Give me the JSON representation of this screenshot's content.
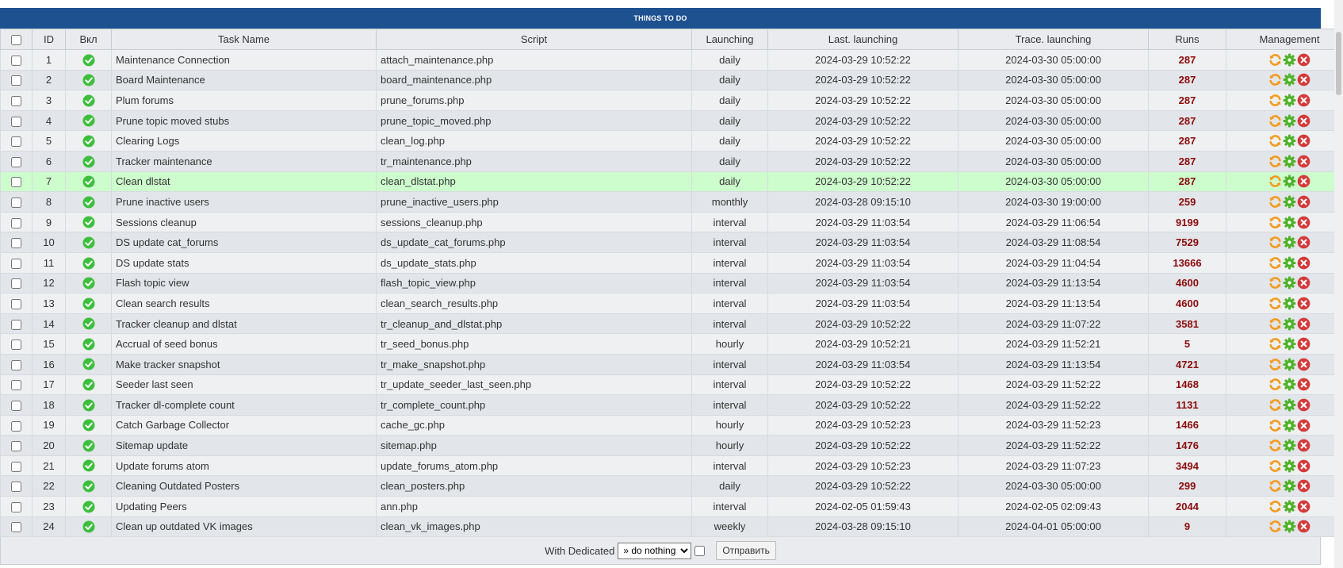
{
  "title": "THINGS TO DO",
  "columns": [
    "",
    "ID",
    "Вкл",
    "Task Name",
    "Script",
    "Launching",
    "Last. launching",
    "Trace. launching",
    "Runs",
    "Management"
  ],
  "rows": [
    {
      "id": "1",
      "name": "Maintenance Connection",
      "script": "attach_maintenance.php",
      "launching": "daily",
      "last": "2024-03-29 10:52:22",
      "next": "2024-03-30 05:00:00",
      "runs": "287"
    },
    {
      "id": "2",
      "name": "Board Maintenance",
      "script": "board_maintenance.php",
      "launching": "daily",
      "last": "2024-03-29 10:52:22",
      "next": "2024-03-30 05:00:00",
      "runs": "287"
    },
    {
      "id": "3",
      "name": "Plum forums",
      "script": "prune_forums.php",
      "launching": "daily",
      "last": "2024-03-29 10:52:22",
      "next": "2024-03-30 05:00:00",
      "runs": "287"
    },
    {
      "id": "4",
      "name": "Prune topic moved stubs",
      "script": "prune_topic_moved.php",
      "launching": "daily",
      "last": "2024-03-29 10:52:22",
      "next": "2024-03-30 05:00:00",
      "runs": "287"
    },
    {
      "id": "5",
      "name": "Clearing Logs",
      "script": "clean_log.php",
      "launching": "daily",
      "last": "2024-03-29 10:52:22",
      "next": "2024-03-30 05:00:00",
      "runs": "287"
    },
    {
      "id": "6",
      "name": "Tracker maintenance",
      "script": "tr_maintenance.php",
      "launching": "daily",
      "last": "2024-03-29 10:52:22",
      "next": "2024-03-30 05:00:00",
      "runs": "287"
    },
    {
      "id": "7",
      "name": "Clean dlstat",
      "script": "clean_dlstat.php",
      "launching": "daily",
      "last": "2024-03-29 10:52:22",
      "next": "2024-03-30 05:00:00",
      "runs": "287",
      "highlight": true
    },
    {
      "id": "8",
      "name": "Prune inactive users",
      "script": "prune_inactive_users.php",
      "launching": "monthly",
      "last": "2024-03-28 09:15:10",
      "next": "2024-03-30 19:00:00",
      "runs": "259"
    },
    {
      "id": "9",
      "name": "Sessions cleanup",
      "script": "sessions_cleanup.php",
      "launching": "interval",
      "last": "2024-03-29 11:03:54",
      "next": "2024-03-29 11:06:54",
      "runs": "9199"
    },
    {
      "id": "10",
      "name": "DS update cat_forums",
      "script": "ds_update_cat_forums.php",
      "launching": "interval",
      "last": "2024-03-29 11:03:54",
      "next": "2024-03-29 11:08:54",
      "runs": "7529"
    },
    {
      "id": "11",
      "name": "DS update stats",
      "script": "ds_update_stats.php",
      "launching": "interval",
      "last": "2024-03-29 11:03:54",
      "next": "2024-03-29 11:04:54",
      "runs": "13666"
    },
    {
      "id": "12",
      "name": "Flash topic view",
      "script": "flash_topic_view.php",
      "launching": "interval",
      "last": "2024-03-29 11:03:54",
      "next": "2024-03-29 11:13:54",
      "runs": "4600"
    },
    {
      "id": "13",
      "name": "Clean search results",
      "script": "clean_search_results.php",
      "launching": "interval",
      "last": "2024-03-29 11:03:54",
      "next": "2024-03-29 11:13:54",
      "runs": "4600"
    },
    {
      "id": "14",
      "name": "Tracker cleanup and dlstat",
      "script": "tr_cleanup_and_dlstat.php",
      "launching": "interval",
      "last": "2024-03-29 10:52:22",
      "next": "2024-03-29 11:07:22",
      "runs": "3581"
    },
    {
      "id": "15",
      "name": "Accrual of seed bonus",
      "script": "tr_seed_bonus.php",
      "launching": "hourly",
      "last": "2024-03-29 10:52:21",
      "next": "2024-03-29 11:52:21",
      "runs": "5"
    },
    {
      "id": "16",
      "name": "Make tracker snapshot",
      "script": "tr_make_snapshot.php",
      "launching": "interval",
      "last": "2024-03-29 11:03:54",
      "next": "2024-03-29 11:13:54",
      "runs": "4721"
    },
    {
      "id": "17",
      "name": "Seeder last seen",
      "script": "tr_update_seeder_last_seen.php",
      "launching": "interval",
      "last": "2024-03-29 10:52:22",
      "next": "2024-03-29 11:52:22",
      "runs": "1468"
    },
    {
      "id": "18",
      "name": "Tracker dl-complete count",
      "script": "tr_complete_count.php",
      "launching": "interval",
      "last": "2024-03-29 10:52:22",
      "next": "2024-03-29 11:52:22",
      "runs": "1131"
    },
    {
      "id": "19",
      "name": "Catch Garbage Collector",
      "script": "cache_gc.php",
      "launching": "hourly",
      "last": "2024-03-29 10:52:23",
      "next": "2024-03-29 11:52:23",
      "runs": "1466"
    },
    {
      "id": "20",
      "name": "Sitemap update",
      "script": "sitemap.php",
      "launching": "hourly",
      "last": "2024-03-29 10:52:22",
      "next": "2024-03-29 11:52:22",
      "runs": "1476"
    },
    {
      "id": "21",
      "name": "Update forums atom",
      "script": "update_forums_atom.php",
      "launching": "interval",
      "last": "2024-03-29 10:52:23",
      "next": "2024-03-29 11:07:23",
      "runs": "3494"
    },
    {
      "id": "22",
      "name": "Cleaning Outdated Posters",
      "script": "clean_posters.php",
      "launching": "daily",
      "last": "2024-03-29 10:52:22",
      "next": "2024-03-30 05:00:00",
      "runs": "299"
    },
    {
      "id": "23",
      "name": "Updating Peers",
      "script": "ann.php",
      "launching": "interval",
      "last": "2024-02-05 01:59:43",
      "next": "2024-02-05 02:09:43",
      "runs": "2044"
    },
    {
      "id": "24",
      "name": "Clean up outdated VK images",
      "script": "clean_vk_images.php",
      "launching": "weekly",
      "last": "2024-03-28 09:15:10",
      "next": "2024-04-01 05:00:00",
      "runs": "9"
    }
  ],
  "icons": {
    "enabled": "check-circle-icon",
    "run": "refresh-icon",
    "edit": "gear-icon",
    "delete": "close-circle-icon"
  },
  "colors": {
    "header_bar": "#1e5190",
    "runs": "#8b0b0b",
    "highlight_row": "#cdfdcd",
    "enabled_icon": "#3dbf3d",
    "run_icon": "#f39a1e",
    "edit_icon": "#4fb22a",
    "delete_icon": "#d43a3a"
  },
  "footer": {
    "label": "With Dedicated",
    "action_select": "» do nothing",
    "submit_label": "Отправить"
  }
}
